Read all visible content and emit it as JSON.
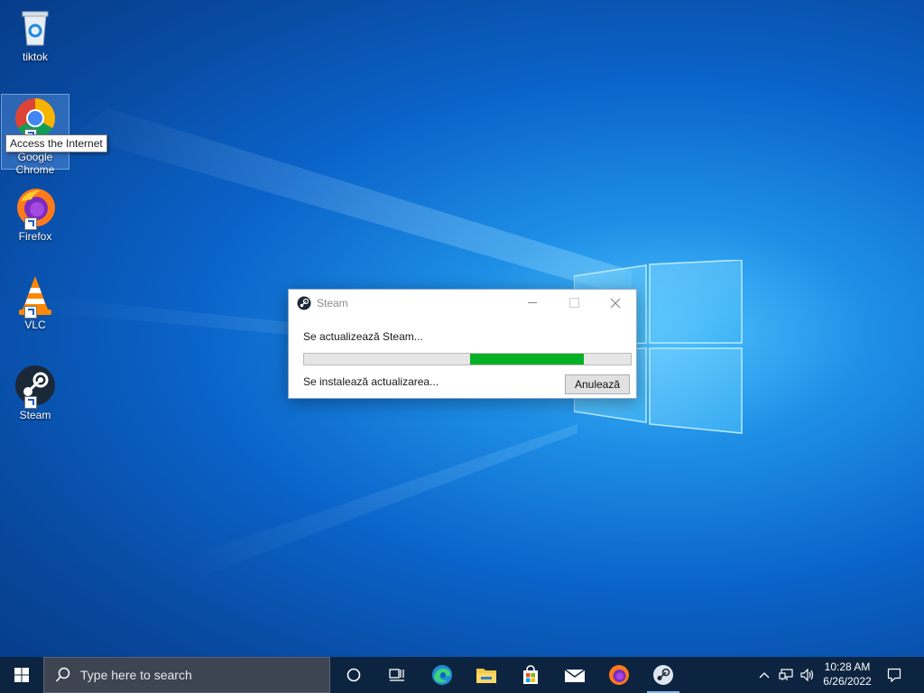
{
  "desktop": {
    "icons": [
      {
        "label": "tiktok",
        "icon": "recycle-bin-icon"
      },
      {
        "label": "Google Chrome",
        "icon": "chrome-icon"
      },
      {
        "label": "Firefox",
        "icon": "firefox-icon"
      },
      {
        "label": "VLC",
        "icon": "vlc-icon"
      },
      {
        "label": "Steam",
        "icon": "steam-icon"
      }
    ],
    "tooltip": "Access the Internet"
  },
  "dialog": {
    "title": "Steam",
    "message": "Se actualizează Steam...",
    "status": "Se instalează actualizarea...",
    "cancel_label": "Anulează",
    "progress": {
      "start": 0.508,
      "end": 0.855
    },
    "progress_color": "#06b025"
  },
  "taskbar": {
    "search_placeholder": "Type here to search",
    "pinned": [
      "cortana-icon",
      "task-view-icon",
      "edge-icon",
      "file-explorer-icon",
      "store-icon",
      "mail-icon",
      "firefox-icon",
      "steam-icon"
    ],
    "tray": [
      "chevron-up-icon",
      "network-icon",
      "volume-icon"
    ],
    "time": "10:28 AM",
    "date": "6/26/2022"
  },
  "colors": {
    "taskbar": "#0d2440",
    "accent": "#0a63c9"
  }
}
